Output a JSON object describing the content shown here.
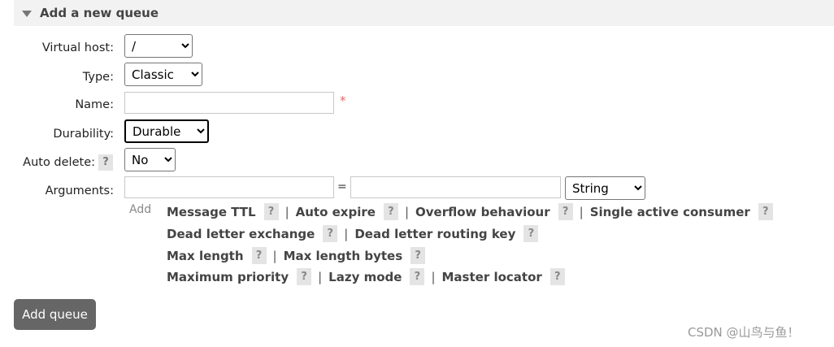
{
  "section": {
    "title": "Add a new queue"
  },
  "form": {
    "virtual_host": {
      "label": "Virtual host:",
      "value": "/"
    },
    "type": {
      "label": "Type:",
      "value": "Classic"
    },
    "name": {
      "label": "Name:",
      "value": "",
      "required_mark": "*"
    },
    "durability": {
      "label": "Durability:",
      "value": "Durable"
    },
    "auto_delete": {
      "label": "Auto delete:",
      "help": "?",
      "value": "No"
    },
    "arguments": {
      "label": "Arguments:",
      "key_value": "",
      "equals": "=",
      "val_value": "",
      "type_value": "String",
      "add_label": "Add"
    }
  },
  "shortcuts": {
    "line1": [
      "Message TTL",
      "Auto expire",
      "Overflow behaviour",
      "Single active consumer"
    ],
    "line2": [
      "Dead letter exchange",
      "Dead letter routing key"
    ],
    "line3": [
      "Max length",
      "Max length bytes"
    ],
    "line4": [
      "Maximum priority",
      "Lazy mode",
      "Master locator"
    ],
    "help": "?",
    "separator": "|"
  },
  "submit": {
    "label": "Add queue"
  },
  "watermark": "CSDN @山鸟与鱼！"
}
